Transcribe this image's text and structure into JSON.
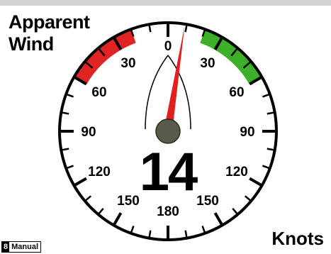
{
  "header": {
    "title_line1": "Apparent",
    "title_line2": "Wind"
  },
  "footer": {
    "units": "Knots",
    "mode_number": "8",
    "mode_label": "Manual"
  },
  "gauge": {
    "wind_angle_deg": 9,
    "speed": "14",
    "scale_labels": [
      {
        "angle": 0,
        "text": "0"
      },
      {
        "angle": -30,
        "text": "30"
      },
      {
        "angle": 30,
        "text": "30"
      },
      {
        "angle": -60,
        "text": "60"
      },
      {
        "angle": 60,
        "text": "60"
      },
      {
        "angle": -90,
        "text": "90"
      },
      {
        "angle": 90,
        "text": "90"
      },
      {
        "angle": -120,
        "text": "120"
      },
      {
        "angle": 120,
        "text": "120"
      },
      {
        "angle": -150,
        "text": "150"
      },
      {
        "angle": 150,
        "text": "150"
      },
      {
        "angle": 180,
        "text": "180"
      }
    ],
    "port_sector_deg": [
      -60,
      -20
    ],
    "starboard_sector_deg": [
      20,
      60
    ],
    "colors": {
      "port": "#e02424",
      "starboard": "#3cb028",
      "needle": "#e0201e",
      "hub": "#5a5a4a"
    }
  }
}
